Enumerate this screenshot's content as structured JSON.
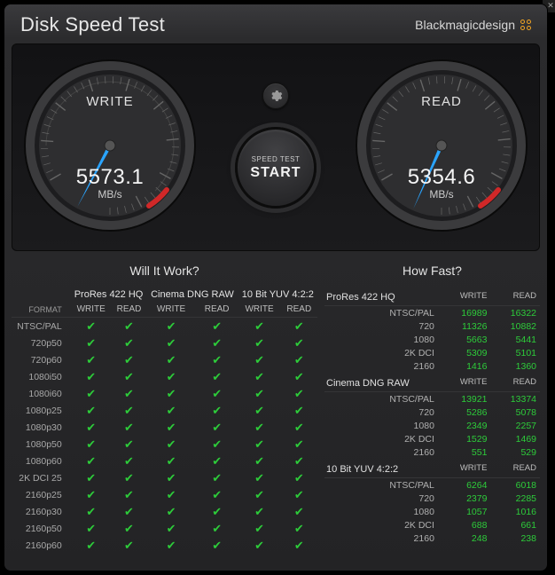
{
  "header": {
    "title": "Disk Speed Test",
    "brand": "Blackmagicdesign"
  },
  "close_label": "✕",
  "gauges": {
    "write": {
      "label": "WRITE",
      "value": "5573.1",
      "unit": "MB/s",
      "angle_deg": 118
    },
    "read": {
      "label": "READ",
      "value": "5354.6",
      "unit": "MB/s",
      "angle_deg": 114
    }
  },
  "start_button": {
    "line1": "SPEED TEST",
    "line2": "START"
  },
  "gear_icon": "gear-icon",
  "will_it_work": {
    "title": "Will It Work?",
    "format_header": "FORMAT",
    "sub_headers": [
      "WRITE",
      "READ"
    ],
    "codecs": [
      "ProRes 422 HQ",
      "Cinema DNG RAW",
      "10 Bit YUV 4:2:2"
    ],
    "rows": [
      {
        "format": "NTSC/PAL",
        "cells": [
          true,
          true,
          true,
          true,
          true,
          true
        ]
      },
      {
        "format": "720p50",
        "cells": [
          true,
          true,
          true,
          true,
          true,
          true
        ]
      },
      {
        "format": "720p60",
        "cells": [
          true,
          true,
          true,
          true,
          true,
          true
        ]
      },
      {
        "format": "1080i50",
        "cells": [
          true,
          true,
          true,
          true,
          true,
          true
        ]
      },
      {
        "format": "1080i60",
        "cells": [
          true,
          true,
          true,
          true,
          true,
          true
        ]
      },
      {
        "format": "1080p25",
        "cells": [
          true,
          true,
          true,
          true,
          true,
          true
        ]
      },
      {
        "format": "1080p30",
        "cells": [
          true,
          true,
          true,
          true,
          true,
          true
        ]
      },
      {
        "format": "1080p50",
        "cells": [
          true,
          true,
          true,
          true,
          true,
          true
        ]
      },
      {
        "format": "1080p60",
        "cells": [
          true,
          true,
          true,
          true,
          true,
          true
        ]
      },
      {
        "format": "2K DCI 25",
        "cells": [
          true,
          true,
          true,
          true,
          true,
          true
        ]
      },
      {
        "format": "2160p25",
        "cells": [
          true,
          true,
          true,
          true,
          true,
          true
        ]
      },
      {
        "format": "2160p30",
        "cells": [
          true,
          true,
          true,
          true,
          true,
          true
        ]
      },
      {
        "format": "2160p50",
        "cells": [
          true,
          true,
          true,
          true,
          true,
          true
        ]
      },
      {
        "format": "2160p60",
        "cells": [
          true,
          true,
          true,
          true,
          true,
          true
        ]
      }
    ]
  },
  "how_fast": {
    "title": "How Fast?",
    "sub_headers": [
      "WRITE",
      "READ"
    ],
    "groups": [
      {
        "codec": "ProRes 422 HQ",
        "rows": [
          {
            "label": "NTSC/PAL",
            "write": "16989",
            "read": "16322"
          },
          {
            "label": "720",
            "write": "11326",
            "read": "10882"
          },
          {
            "label": "1080",
            "write": "5663",
            "read": "5441"
          },
          {
            "label": "2K DCI",
            "write": "5309",
            "read": "5101"
          },
          {
            "label": "2160",
            "write": "1416",
            "read": "1360"
          }
        ]
      },
      {
        "codec": "Cinema DNG RAW",
        "rows": [
          {
            "label": "NTSC/PAL",
            "write": "13921",
            "read": "13374"
          },
          {
            "label": "720",
            "write": "5286",
            "read": "5078"
          },
          {
            "label": "1080",
            "write": "2349",
            "read": "2257"
          },
          {
            "label": "2K DCI",
            "write": "1529",
            "read": "1469"
          },
          {
            "label": "2160",
            "write": "551",
            "read": "529"
          }
        ]
      },
      {
        "codec": "10 Bit YUV 4:2:2",
        "rows": [
          {
            "label": "NTSC/PAL",
            "write": "6264",
            "read": "6018"
          },
          {
            "label": "720",
            "write": "2379",
            "read": "2285"
          },
          {
            "label": "1080",
            "write": "1057",
            "read": "1016"
          },
          {
            "label": "2K DCI",
            "write": "688",
            "read": "661"
          },
          {
            "label": "2160",
            "write": "248",
            "read": "238"
          }
        ]
      }
    ]
  }
}
